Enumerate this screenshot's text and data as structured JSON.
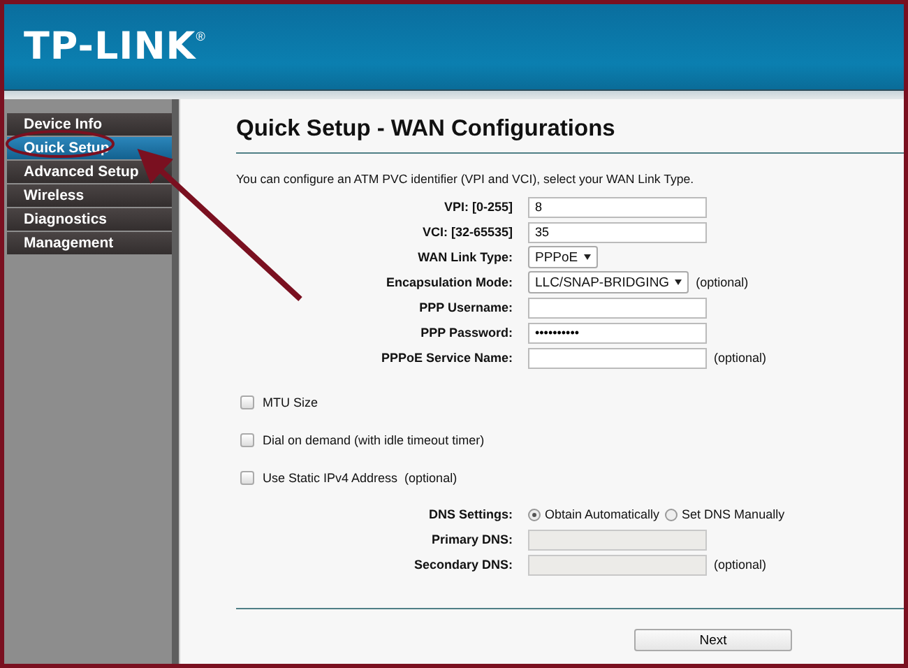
{
  "header": {
    "logo": "TP-LINK",
    "trademark": "®"
  },
  "sidebar": {
    "items": [
      {
        "label": "Device Info",
        "selected": false
      },
      {
        "label": "Quick Setup",
        "selected": true
      },
      {
        "label": "Advanced Setup",
        "selected": false
      },
      {
        "label": "Wireless",
        "selected": false
      },
      {
        "label": "Diagnostics",
        "selected": false
      },
      {
        "label": "Management",
        "selected": false
      }
    ]
  },
  "page": {
    "title": "Quick Setup - WAN Configurations",
    "intro": "You can configure an ATM PVC identifier (VPI and VCI), select your WAN Link Type.",
    "fields": [
      {
        "kind": "input",
        "label": "VPI: [0-255]",
        "value": "8"
      },
      {
        "kind": "input",
        "label": "VCI: [32-65535]",
        "value": "35"
      },
      {
        "kind": "select",
        "label": "WAN Link Type:",
        "value": "PPPoE"
      },
      {
        "kind": "select",
        "label": "Encapsulation Mode:",
        "value": "LLC/SNAP-BRIDGING",
        "note": "(optional)"
      },
      {
        "kind": "input",
        "label": "PPP Username:"
      },
      {
        "kind": "input",
        "label": "PPP Password:",
        "value": "••••••••••"
      },
      {
        "kind": "input",
        "label": "PPPoE Service Name:",
        "note": "(optional)"
      }
    ],
    "options": [
      {
        "label": "MTU Size",
        "checked": false
      },
      {
        "label": "Dial on demand (with idle timeout timer)",
        "checked": false
      },
      {
        "label": "Use Static IPv4 Address  (optional)",
        "checked": false
      }
    ],
    "dns": {
      "label": "DNS Settings:",
      "choices": [
        {
          "label": "Obtain Automatically",
          "selected": true
        },
        {
          "label": "Set DNS Manually",
          "selected": false
        }
      ],
      "fields": [
        {
          "label": "Primary DNS:",
          "disabled": true
        },
        {
          "label": "Secondary DNS:",
          "disabled": true,
          "note": "(optional)"
        }
      ]
    },
    "next_button": "Next"
  }
}
